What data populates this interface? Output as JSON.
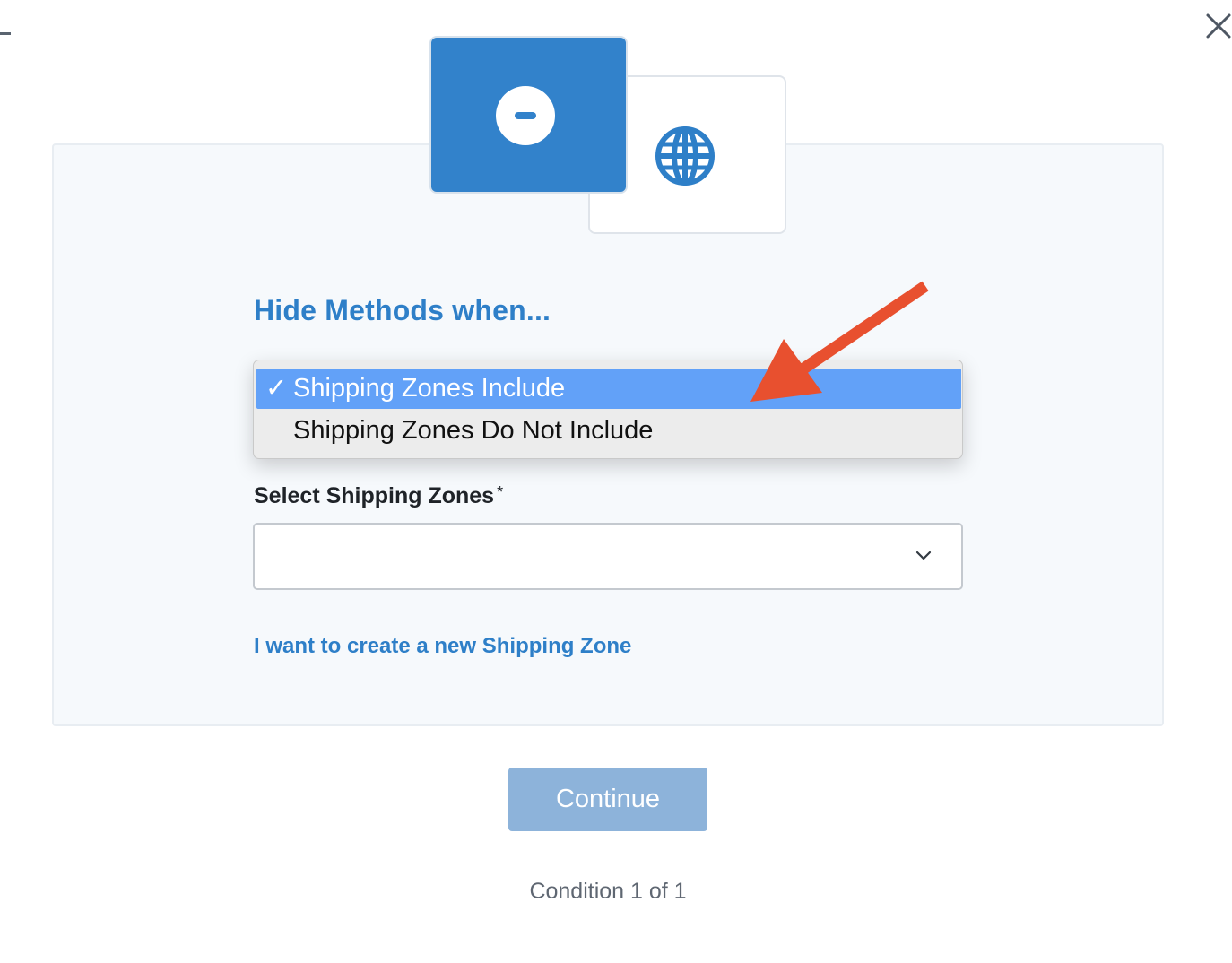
{
  "window": {
    "close_icon": "close-icon"
  },
  "illustration": {
    "primary_icon": "minus-circle-icon",
    "secondary_icon": "globe-icon",
    "accent_color": "#3282cb"
  },
  "form": {
    "heading": "Hide Methods when...",
    "condition_dropdown": {
      "options": [
        {
          "label": "Shipping Zones Include",
          "selected": true,
          "check": "✓"
        },
        {
          "label": "Shipping Zones Do Not Include",
          "selected": false,
          "check": ""
        }
      ],
      "highlight_color": "#62a1f8"
    },
    "zones_field": {
      "label": "Select Shipping Zones",
      "required_mark": "*",
      "value": "",
      "chevron_icon": "chevron-down-icon"
    },
    "create_zone_link": "I want to create a new Shipping Zone"
  },
  "footer": {
    "continue_label": "Continue",
    "continue_color": "#8db3da",
    "progress": "Condition 1 of 1"
  },
  "annotation": {
    "arrow_icon": "red-arrow-icon",
    "arrow_color": "#e8502f"
  }
}
